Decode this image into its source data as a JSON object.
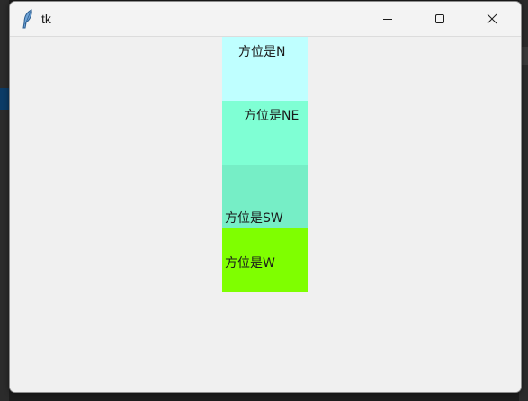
{
  "window": {
    "title": "tk",
    "icon": "feather-icon"
  },
  "controls": {
    "minimize_icon": "minimize-icon",
    "maximize_icon": "maximize-icon",
    "close_icon": "close-icon"
  },
  "labels": [
    {
      "text": "方位是N",
      "anchor": "N",
      "color": "#bfffff"
    },
    {
      "text": "方位是NE",
      "anchor": "NE",
      "color": "#7fffd4"
    },
    {
      "text": "方位是SW",
      "anchor": "SW",
      "color": "#76eec6"
    },
    {
      "text": "方位是W",
      "anchor": "W",
      "color": "#7fff00"
    }
  ]
}
